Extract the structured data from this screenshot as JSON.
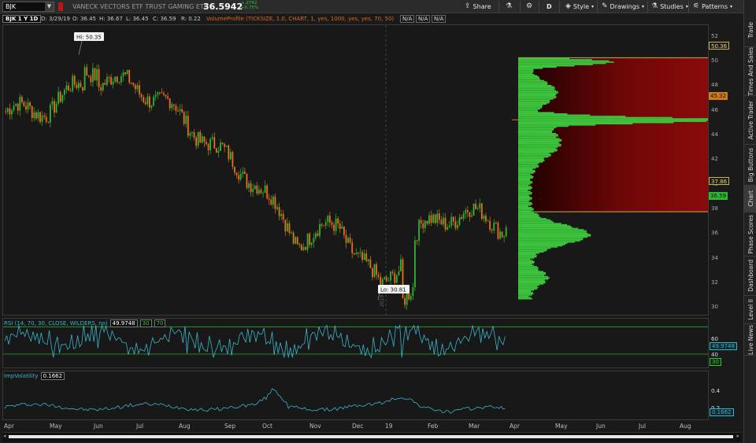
{
  "toolbar": {
    "symbol": "BJK",
    "description": "VANECK VECTORS ETF TRUST GAMING ETF",
    "last_price": "36.5942",
    "change_net": "+.2742",
    "change_pct": "+0.75%",
    "share_label": "Share",
    "period_label": "D",
    "style_label": "Style",
    "drawings_label": "Drawings",
    "studies_label": "Studies",
    "patterns_label": "Patterns"
  },
  "header": {
    "chart_id": "BJK 1 Y 1D",
    "date": "D: 3/29/19",
    "open": "O: 36.45",
    "high": "H: 36.67",
    "low": "L: 36.45",
    "close": "C: 36.59",
    "range": "R: 0.22",
    "volume_profile": "VolumeProfile (TICKSIZE, 1.0, CHART, 1, yes, 1000, yes, yes, 70, 50)",
    "na1": "N/A",
    "na2": "N/A",
    "na3": "N/A"
  },
  "price_axis": [
    "52",
    "50",
    "48",
    "46",
    "44",
    "42",
    "40",
    "38",
    "36",
    "34",
    "32",
    "30"
  ],
  "price_tags": {
    "top": "50.36",
    "poc": "45.32",
    "bottom": "37.86",
    "last": "36.59"
  },
  "annotations": {
    "hi": "Hi: 50.35",
    "lo": "Lo: 30.81",
    "year_marker": "2019"
  },
  "rsi": {
    "label": "RSI (14, 70, 30, CLOSE, WILDERS, no)",
    "value": "49.9748",
    "lower": "30",
    "upper": "70",
    "axis": [
      "60",
      "40"
    ],
    "last_tag": "49.9748",
    "lower_tag": "30"
  },
  "iv": {
    "label": "ImpVolatility",
    "value": "0.1662",
    "axis": [
      "0.4",
      "0.2"
    ],
    "last_tag": "0.1662"
  },
  "x_axis": [
    "Apr",
    "May",
    "Jun",
    "Jul",
    "Aug",
    "Sep",
    "Oct",
    "Nov",
    "Dec",
    "19",
    "Feb",
    "Mar",
    "Apr",
    "May",
    "Jun",
    "Jul",
    "Aug"
  ],
  "sidebar": [
    "Trade",
    "Times And Sales",
    "Active Trader",
    "Big Buttons",
    "Chart",
    "Phase Scores",
    "Dashboard",
    "Level II",
    "Live News"
  ],
  "colors": {
    "up": "#2fb52f",
    "down": "#e5701f",
    "volume_profile": "#3cc43c",
    "value_area": "#8b0a0a",
    "rsi_line": "#3bb4c7",
    "iv_line": "#3bb4c7",
    "accent": "#c7b24a"
  },
  "chart_data": {
    "type": "candlestick",
    "title": "BJK 1 Y 1D",
    "x_range": [
      "2018-04",
      "2019-03"
    ],
    "ylim": [
      29.5,
      53
    ],
    "high": 50.35,
    "low": 30.81,
    "last": 36.59,
    "monthly_closes": [
      {
        "month": "Apr",
        "close": 46.2
      },
      {
        "month": "May",
        "close": 48.6
      },
      {
        "month": "Jun",
        "close": 48.3
      },
      {
        "month": "Jul",
        "close": 46.2
      },
      {
        "month": "Aug",
        "close": 43.0
      },
      {
        "month": "Sep",
        "close": 40.3
      },
      {
        "month": "Oct",
        "close": 35.5
      },
      {
        "month": "Nov",
        "close": 36.8
      },
      {
        "month": "Dec",
        "close": 31.5
      },
      {
        "month": "Jan",
        "close": 36.6
      },
      {
        "month": "Feb",
        "close": 37.9
      },
      {
        "month": "Mar",
        "close": 36.59
      }
    ],
    "volume_profile": {
      "poc": 45.32,
      "value_area_high": 50.36,
      "value_area_low": 37.86
    },
    "rsi_value": 49.9748,
    "iv_value": 0.1662
  }
}
